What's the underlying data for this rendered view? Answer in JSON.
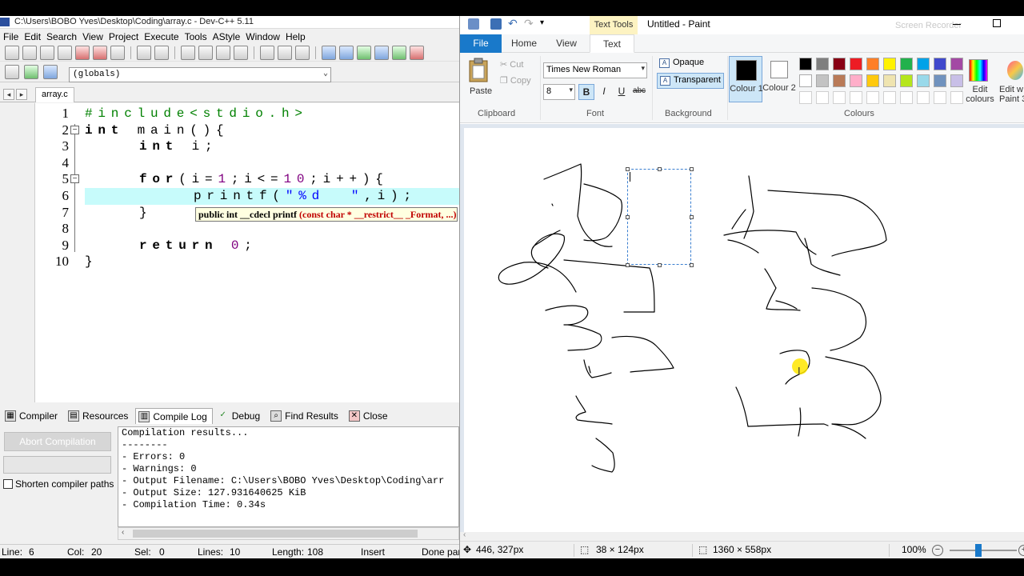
{
  "devcpp": {
    "title": "C:\\Users\\BOBO Yves\\Desktop\\Coding\\array.c - Dev-C++ 5.11",
    "menu": [
      "File",
      "Edit",
      "Search",
      "View",
      "Project",
      "Execute",
      "Tools",
      "AStyle",
      "Window",
      "Help"
    ],
    "scope_dropdown": "(globals)",
    "file_tab": "array.c",
    "line_numbers": [
      "1",
      "2",
      "3",
      "4",
      "5",
      "6",
      "7",
      "8",
      "9",
      "10"
    ],
    "code": {
      "l1": "#include<stdio.h>",
      "l2_kw": "int",
      "l2_rest": " main(){",
      "l3_kw": "int",
      "l3_rest": " i;",
      "l5_kw": "for",
      "l5_a": "(i=",
      "l5_n1": "1",
      "l5_b": ";i<=",
      "l5_n2": "10",
      "l5_c": ";i++){",
      "l6_a": "printf(",
      "l6_str": "\"%d  \"",
      "l6_b": ",i);",
      "l7": "}",
      "l9_kw": "return",
      "l9_n": "0",
      "l9_b": ";",
      "l10": "}"
    },
    "tooltip": {
      "signature": "public int __cdecl printf",
      "args": "(const char * __restrict__ _Format, ...)"
    },
    "bottom_tabs": [
      {
        "label": "Compiler",
        "icon": "grid-icon"
      },
      {
        "label": "Resources",
        "icon": "resources-icon"
      },
      {
        "label": "Compile Log",
        "icon": "chart-icon"
      },
      {
        "label": "Debug",
        "icon": "check-icon"
      },
      {
        "label": "Find Results",
        "icon": "search-icon"
      },
      {
        "label": "Close",
        "icon": "close-icon"
      }
    ],
    "abort_button": "Abort Compilation",
    "shorten_paths": "Shorten compiler paths",
    "log": [
      "Compilation results...",
      "--------",
      "- Errors: 0",
      "- Warnings: 0",
      "- Output Filename: C:\\Users\\BOBO Yves\\Desktop\\Coding\\arr",
      "- Output Size: 127.931640625 KiB",
      "- Compilation Time: 0.34s"
    ],
    "status": {
      "line_label": "Line:",
      "line": "6",
      "col_label": "Col:",
      "col": "20",
      "sel_label": "Sel:",
      "sel": "0",
      "lines_label": "Lines:",
      "lines": "10",
      "length_label": "Length:",
      "length": "108",
      "mode": "Insert",
      "done": "Done par"
    }
  },
  "paint": {
    "contextual_tab": "Text Tools",
    "window_title": "Untitled - Paint",
    "tabs": {
      "file": "File",
      "home": "Home",
      "view": "View",
      "text": "Text"
    },
    "clipboard": {
      "paste": "Paste",
      "cut": "Cut",
      "copy": "Copy",
      "group": "Clipboard"
    },
    "font": {
      "family": "Times New Roman",
      "size": "8",
      "bold": "B",
      "italic": "I",
      "underline": "U",
      "strike": "abc",
      "group": "Font"
    },
    "background": {
      "opaque": "Opaque",
      "transparent": "Transparent",
      "group": "Background"
    },
    "colours": {
      "colour1": "Colour 1",
      "colour2": "Colour 2",
      "group": "Colours",
      "edit": "Edit colours",
      "edit_paint3d": "Edit w Paint 3",
      "colour1_value": "#000000",
      "colour2_value": "#ffffff",
      "palette_row1": [
        "#000000",
        "#7f7f7f",
        "#880015",
        "#ed1c24",
        "#ff7f27",
        "#fff200",
        "#22b14c",
        "#00a2e8",
        "#3f48cc",
        "#a349a4"
      ],
      "palette_row2": [
        "#ffffff",
        "#c3c3c3",
        "#b97a57",
        "#ffaec9",
        "#ffc90e",
        "#efe4b0",
        "#b5e61d",
        "#99d9ea",
        "#7092be",
        "#c8bfe7"
      ],
      "palette_row3": [
        "#ffffff",
        "#ffffff",
        "#ffffff",
        "#ffffff",
        "#ffffff",
        "#ffffff",
        "#ffffff",
        "#ffffff",
        "#ffffff",
        "#ffffff"
      ]
    },
    "status": {
      "cursor": "446, 327px",
      "selection": "38 × 124px",
      "canvas_size": "1360 × 558px",
      "zoom": "100%"
    },
    "watermark": "Screen Recorder"
  }
}
